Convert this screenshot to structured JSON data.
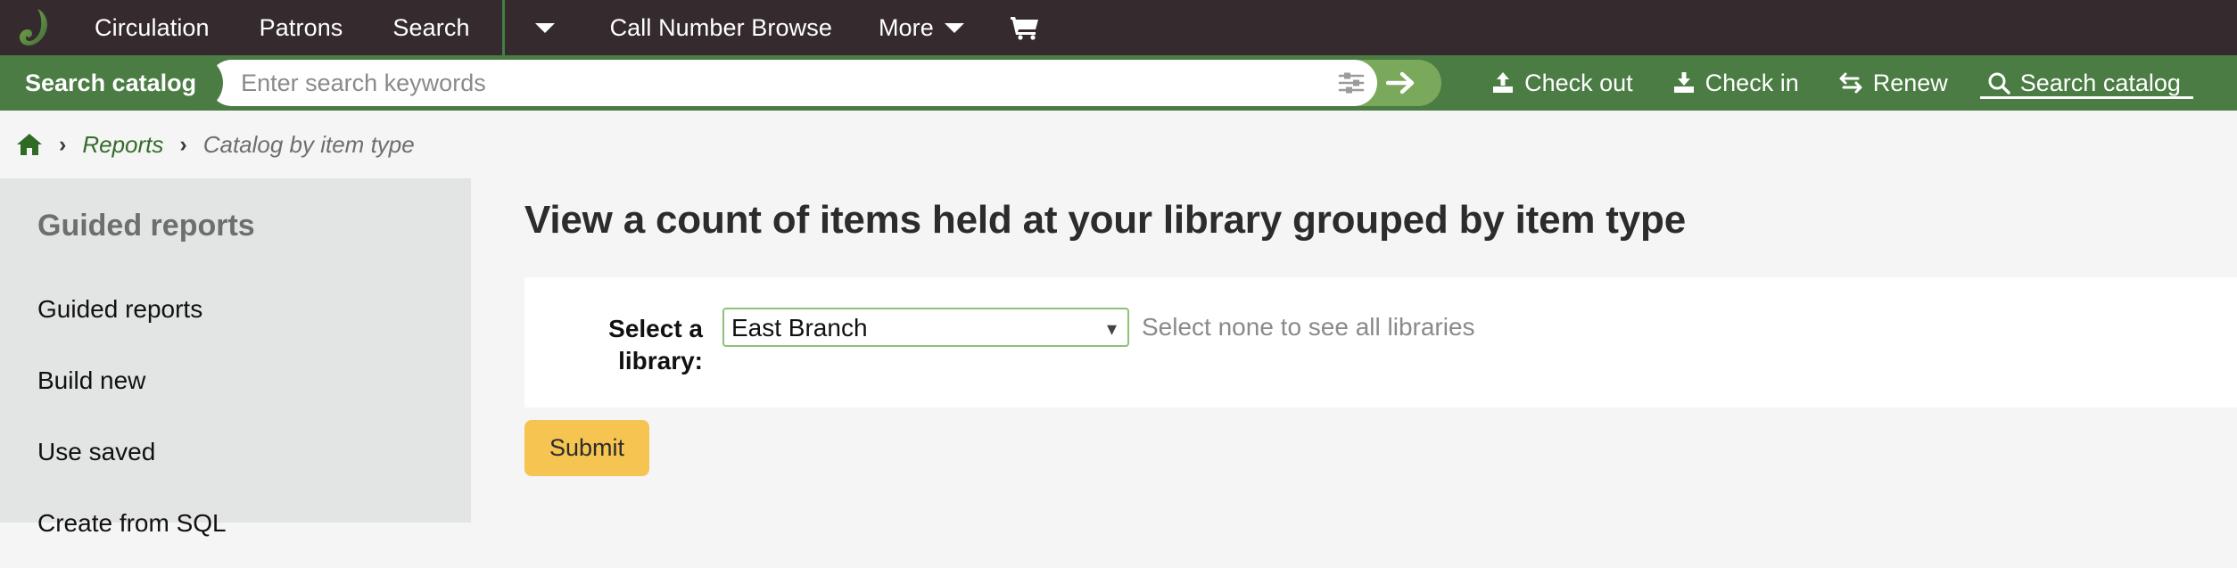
{
  "colors": {
    "navbar_bg": "#352b2e",
    "accent_green": "#4a7c43",
    "accent_light_green": "#7aa95c",
    "sidebar_bg": "#e3e4e4",
    "page_bg": "#f4f5f4",
    "submit_yellow": "#f5c451",
    "select_border": "#8dc177",
    "breadcrumb_link": "#356b2b"
  },
  "topnav": {
    "logo_icon": "koha-leaf-logo",
    "items": [
      {
        "label": "Circulation",
        "icon": ""
      },
      {
        "label": "Patrons",
        "icon": ""
      },
      {
        "label": "Search",
        "icon": ""
      }
    ],
    "dropdown_caret_icon": "chevron-down-icon",
    "call_number_browse_label": "Call Number Browse",
    "more_label": "More",
    "more_caret_icon": "chevron-down-icon",
    "cart_icon": "shopping-cart-icon"
  },
  "searchbar": {
    "tab_label": "Search catalog",
    "input_value": "",
    "input_placeholder": "Enter search keywords",
    "filter_icon": "sliders-icon",
    "submit_icon": "arrow-right-icon",
    "toolbar": [
      {
        "label": "Check out",
        "icon": "upload-arrow-icon",
        "active": false
      },
      {
        "label": "Check in",
        "icon": "download-arrow-icon",
        "active": false
      },
      {
        "label": "Renew",
        "icon": "renew-exchange-icon",
        "active": false
      },
      {
        "label": "Search catalog",
        "icon": "magnifier-icon",
        "active": true
      }
    ]
  },
  "breadcrumb": {
    "home_icon": "home-icon",
    "separator": "›",
    "link_label": "Reports",
    "current_label": "Catalog by item type"
  },
  "sidebar": {
    "heading": "Guided reports",
    "items": [
      {
        "label": "Guided reports"
      },
      {
        "label": "Build new"
      },
      {
        "label": "Use saved"
      },
      {
        "label": "Create from SQL"
      }
    ]
  },
  "main": {
    "page_title": "View a count of items held at your library grouped by item type",
    "form": {
      "library_label": "Select a library:",
      "library_selected": "East Branch",
      "library_options": [
        "East Branch"
      ],
      "library_hint": "Select none to see all libraries",
      "select_caret_icon": "chevron-down-icon",
      "submit_label": "Submit"
    }
  }
}
